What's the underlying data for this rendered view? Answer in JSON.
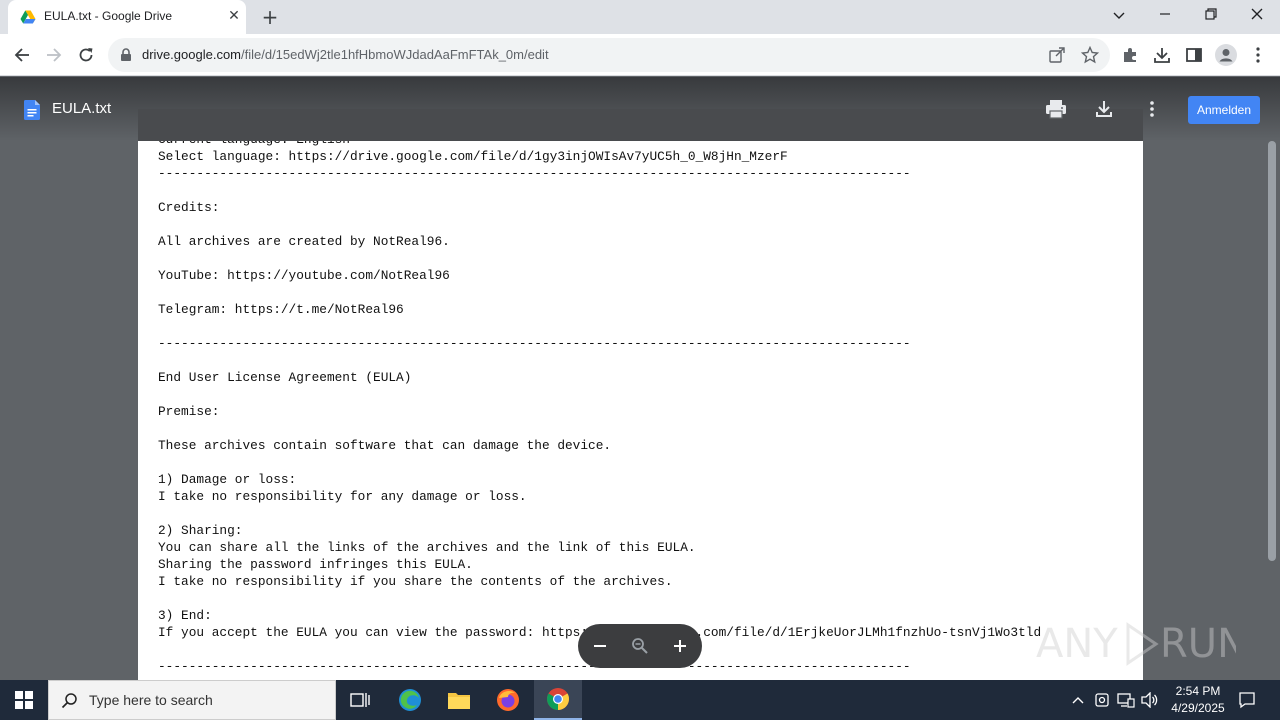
{
  "browser": {
    "tab_title": "EULA.txt - Google Drive",
    "url_host": "drive.google.com",
    "url_path": "/file/d/15edWj2tle1hfHbmoWJdadAaFmFTAk_0m/edit"
  },
  "viewer": {
    "doc_title": "EULA.txt",
    "signin_label": "Anmelden",
    "lines": [
      "Current language: English",
      "Select language: https://drive.google.com/file/d/1gy3injOWIsAv7yUC5h_0_W8jHn_MzerF",
      "--------------------------------------------------------------------------------------------------",
      "",
      "Credits:",
      "",
      "All archives are created by NotReal96.",
      "",
      "YouTube: https://youtube.com/NotReal96",
      "",
      "Telegram: https://t.me/NotReal96",
      "",
      "--------------------------------------------------------------------------------------------------",
      "",
      "End User License Agreement (EULA)",
      "",
      "Premise:",
      "",
      "These archives contain software that can damage the device.",
      "",
      "1) Damage or loss:",
      "I take no responsibility for any damage or loss.",
      "",
      "2) Sharing:",
      "You can share all the links of the archives and the link of this EULA.",
      "Sharing the password infringes this EULA.",
      "I take no responsibility if you share the contents of the archives.",
      "",
      "3) End:",
      "If you accept the EULA you can view the password: https://drive.google.com/file/d/1ErjkeUorJLMh1fnzhUo-tsnVj1Wo3tld",
      "",
      "--------------------------------------------------------------------------------------------------"
    ]
  },
  "watermark": "ANY RUN",
  "taskbar": {
    "search_placeholder": "Type here to search",
    "time": "2:54 PM",
    "date": "4/29/2025"
  },
  "icons": {
    "back": "arrow-left-icon",
    "forward": "arrow-right-icon",
    "reload": "reload-icon",
    "print": "printer-icon",
    "download": "download-icon",
    "more": "more-vert-icon"
  },
  "colors": {
    "accent": "#4285f4",
    "viewer_bg": "#5f6367",
    "taskbar": "#1f2a3a"
  }
}
